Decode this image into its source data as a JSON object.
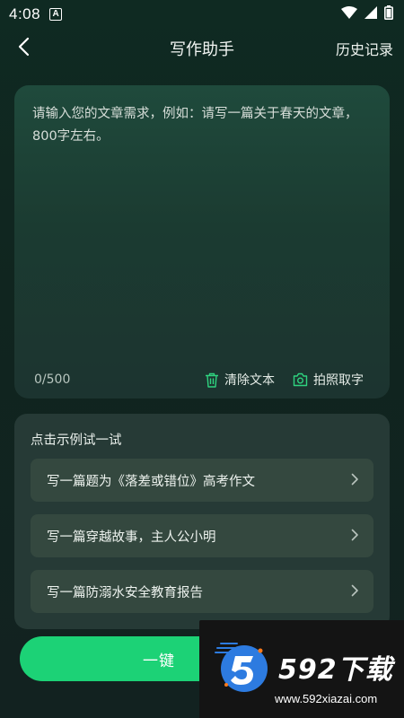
{
  "status_bar": {
    "time": "4:08",
    "notification_letter": "A"
  },
  "header": {
    "title": "写作助手",
    "history_label": "历史记录"
  },
  "editor": {
    "placeholder": "请输入您的文章需求，例如：请写一篇关于春天的文章，800字左右。",
    "value": "",
    "char_count": "0/500",
    "clear_label": "清除文本",
    "photo_label": "拍照取字"
  },
  "samples": {
    "header": "点击示例试一试",
    "items": [
      {
        "label": "写一篇题为《落差或错位》高考作文"
      },
      {
        "label": "写一篇穿越故事，主人公小明"
      },
      {
        "label": "写一篇防溺水安全教育报告"
      }
    ]
  },
  "bottom_button": {
    "label": "一键"
  },
  "watermark": {
    "title": "592下载",
    "url": "www.592xiazai.com"
  },
  "colors": {
    "accent": "#1cd276",
    "card_bg": "#1f4a3c",
    "samples_bg": "#263a36",
    "sample_item_bg": "#34483f"
  }
}
